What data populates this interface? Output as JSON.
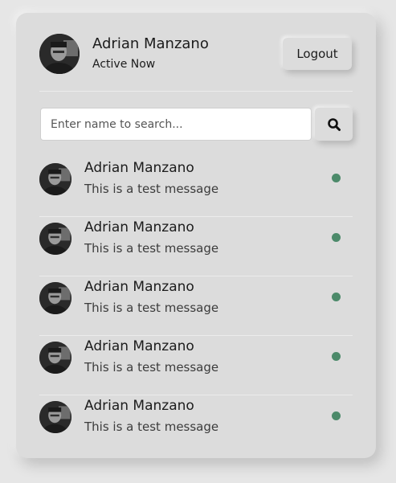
{
  "header": {
    "name": "Adrian Manzano",
    "status": "Active Now",
    "logout_label": "Logout"
  },
  "search": {
    "placeholder": "Enter name to search...",
    "value": ""
  },
  "colors": {
    "online": "#4c8a6a"
  },
  "users": [
    {
      "name": "Adrian Manzano",
      "message": "This is a test message",
      "status": "online"
    },
    {
      "name": "Adrian Manzano",
      "message": "This is a test message",
      "status": "online"
    },
    {
      "name": "Adrian Manzano",
      "message": "This is a test message",
      "status": "online"
    },
    {
      "name": "Adrian Manzano",
      "message": "This is a test message",
      "status": "online"
    },
    {
      "name": "Adrian Manzano",
      "message": "This is a test message",
      "status": "online"
    }
  ]
}
